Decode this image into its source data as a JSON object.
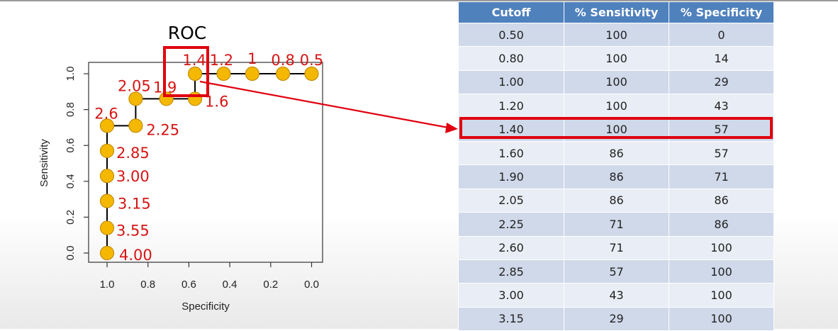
{
  "chart_data": {
    "type": "line",
    "title": "ROC",
    "xlabel": "Specificity",
    "ylabel": "Sensitivity",
    "xlim": [
      1.0,
      0.0
    ],
    "ylim": [
      0.0,
      1.0
    ],
    "x_reversed": true,
    "xticks": [
      "1.0",
      "0.8",
      "0.6",
      "0.4",
      "0.2",
      "0.0"
    ],
    "yticks": [
      "0.0",
      "0.2",
      "0.4",
      "0.6",
      "0.8",
      "1.0"
    ],
    "series": [
      {
        "specificity": [
          0,
          0.14,
          0.29,
          0.43,
          0.57,
          0.57,
          0.71,
          0.86,
          0.86,
          1.0,
          1.0,
          1.0,
          1.0,
          1.0,
          1.0
        ],
        "sensitivity": [
          1.0,
          1.0,
          1.0,
          1.0,
          1.0,
          0.86,
          0.86,
          0.86,
          0.71,
          0.71,
          0.57,
          0.43,
          0.29,
          0.14,
          0.0
        ],
        "point_labels": [
          "0.5",
          "0.8",
          "1",
          "1.2",
          "1.4",
          "1.6",
          "1.9",
          "2.05",
          "2.25",
          "2.6",
          "2.85",
          "3.00",
          "3.15",
          "3.55",
          "4.00"
        ]
      }
    ],
    "highlighted_point_label": "1.4",
    "grid": false,
    "colors": {
      "point_fill": "#f5b800",
      "point_stroke": "#c48c00",
      "label": "#d61414",
      "highlight": "#e0000f",
      "line": "#000000"
    }
  },
  "table": {
    "headers": [
      "Cutoff",
      "% Sensitivity",
      "% Specificity"
    ],
    "rows": [
      [
        "0.50",
        "100",
        "0"
      ],
      [
        "0.80",
        "100",
        "14"
      ],
      [
        "1.00",
        "100",
        "29"
      ],
      [
        "1.20",
        "100",
        "43"
      ],
      [
        "1.40",
        "100",
        "57"
      ],
      [
        "1.60",
        "86",
        "57"
      ],
      [
        "1.90",
        "86",
        "71"
      ],
      [
        "2.05",
        "86",
        "86"
      ],
      [
        "2.25",
        "71",
        "86"
      ],
      [
        "2.60",
        "71",
        "100"
      ],
      [
        "2.85",
        "57",
        "100"
      ],
      [
        "3.00",
        "43",
        "100"
      ],
      [
        "3.15",
        "29",
        "100"
      ]
    ],
    "highlighted_row_index": 4,
    "colors": {
      "header": "#4f81bd",
      "row_odd": "#d0d9ea",
      "row_even": "#e9edf5"
    }
  }
}
